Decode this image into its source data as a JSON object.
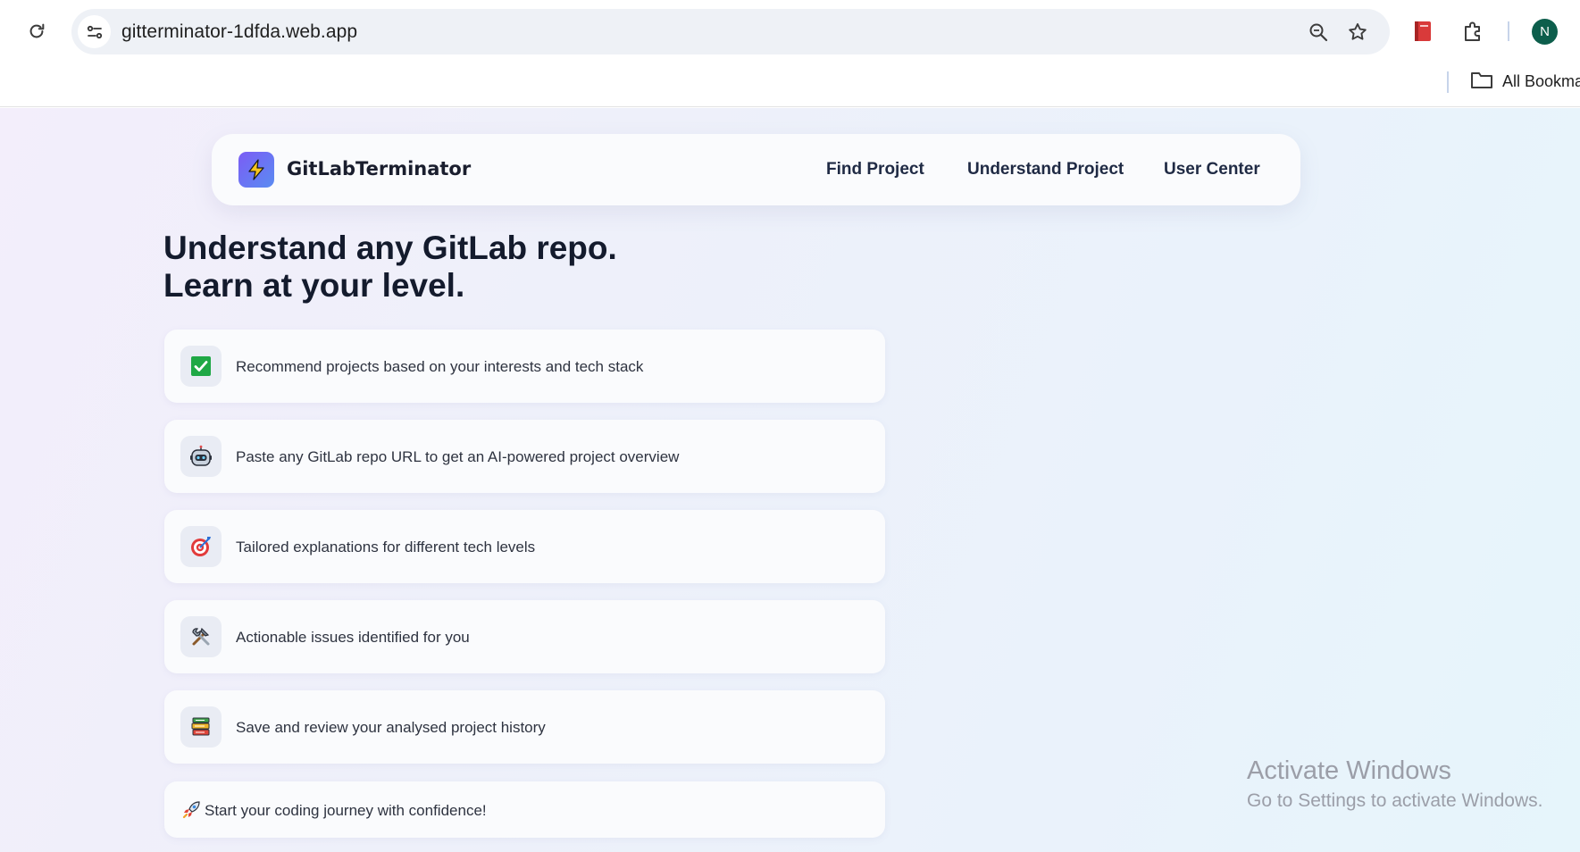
{
  "browser": {
    "url": "gitterminator-1dfda.web.app",
    "profile_initial": "N",
    "bookmarks_label": "All Bookma",
    "icons": {
      "reload": "reload-icon",
      "site_info": "tune-icon",
      "zoom": "zoom-icon",
      "bookmark": "star-icon",
      "extension_1": "red-book-extension-icon",
      "extensions": "puzzle-icon",
      "bookmarks_folder": "folder-icon"
    }
  },
  "nav": {
    "brand": "GitLabTerminator",
    "logo_icon": "lightning-icon",
    "links": [
      "Find Project",
      "Understand Project",
      "User Center"
    ]
  },
  "hero": {
    "line1": "Understand any GitLab repo.",
    "line2": "Learn at your level."
  },
  "features": [
    {
      "icon": "checkmark-icon",
      "text": "Recommend projects based on your interests and tech stack"
    },
    {
      "icon": "robot-icon",
      "text": "Paste any GitLab repo URL to get an AI-powered project overview"
    },
    {
      "icon": "target-icon",
      "text": "Tailored explanations for different tech levels"
    },
    {
      "icon": "tools-icon",
      "text": "Actionable issues identified for you"
    },
    {
      "icon": "books-icon",
      "text": "Save and review your analysed project history"
    }
  ],
  "cta": {
    "icon": "rocket-icon",
    "text": "Start your coding journey with confidence!"
  },
  "watermark": {
    "title": "Activate Windows",
    "subtitle": "Go to Settings to activate Windows."
  },
  "colors": {
    "logo_gradient_start": "#7b5cf5",
    "logo_gradient_end": "#5a8cf2",
    "avatar": "#0d5e4c",
    "check_green": "#1fa845"
  }
}
